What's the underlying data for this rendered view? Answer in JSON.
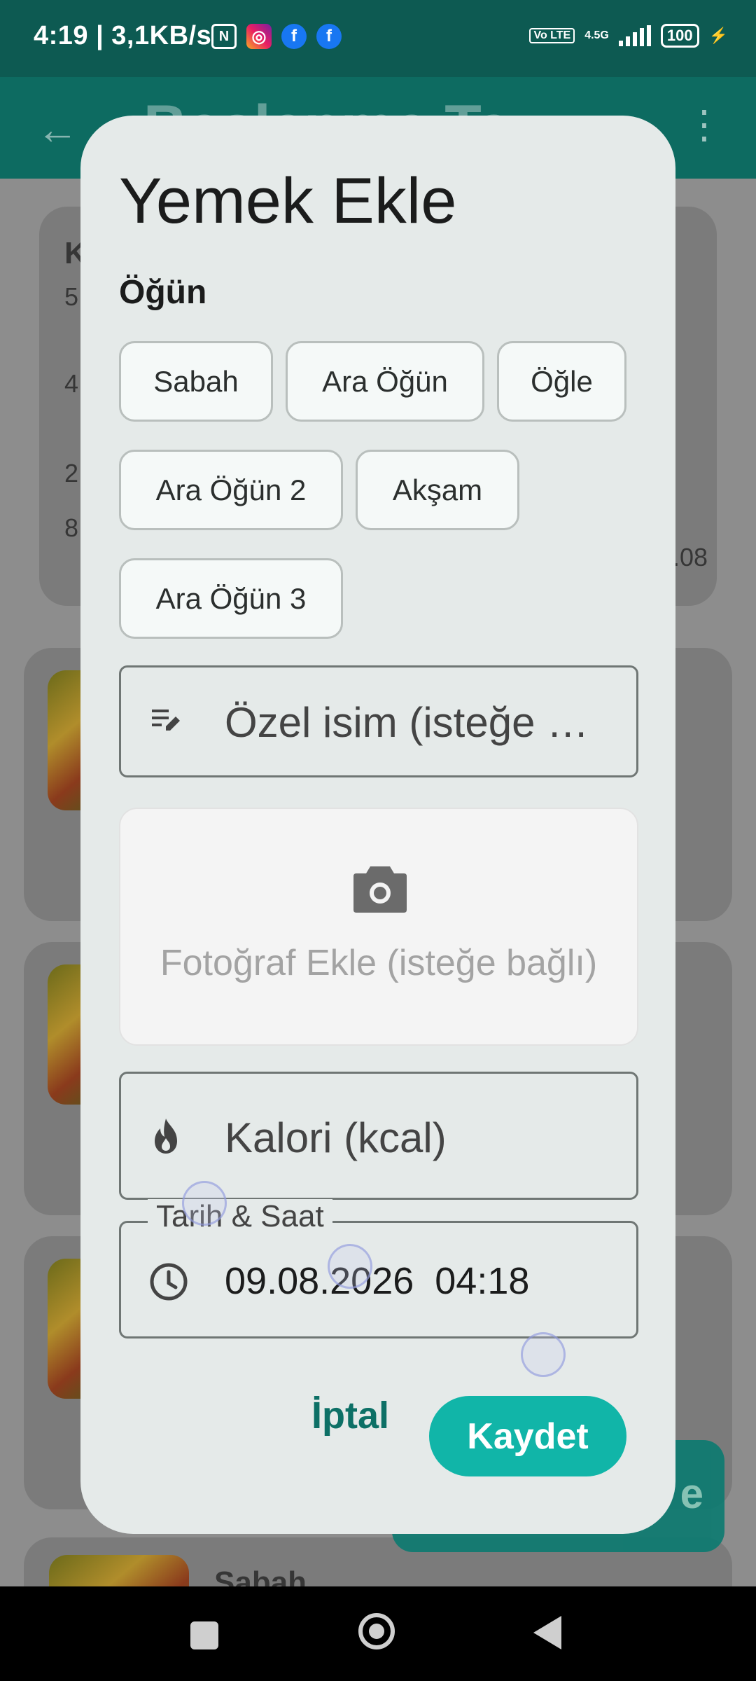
{
  "status_bar": {
    "time": "4:19 | 3,1KB/s",
    "network": "4.5G",
    "volte": "Vo LTE",
    "battery": "100"
  },
  "app_bar": {
    "title": "Beslenme Ta",
    "back_icon": "arrow-back-icon",
    "more_icon": "more-vert-icon"
  },
  "background": {
    "card_initial": "K",
    "left_numbers": [
      "5",
      "4",
      "2",
      "8"
    ],
    "right_date": ".08",
    "bottom_item_title": "Sabah",
    "fab_label": "e"
  },
  "dialog": {
    "title": "Yemek Ekle",
    "meal_section_label": "Öğün",
    "meal_chips": [
      "Sabah",
      "Ara Öğün",
      "Öğle",
      "Ara Öğün 2",
      "Akşam",
      "Ara Öğün 3"
    ],
    "custom_name_placeholder": "Özel isim (isteğe …",
    "photo_label": "Fotoğraf Ekle (isteğe bağlı)",
    "calorie_placeholder": "Kalori (kcal)",
    "datetime_label": "Tarih & Saat",
    "datetime_value": "09.08.2026  04:18",
    "cancel_label": "İptal",
    "save_label": "Kaydet"
  },
  "colors": {
    "primary": "#0d6b61",
    "accent": "#11b5a8",
    "dialog_bg": "#e5eae9"
  }
}
